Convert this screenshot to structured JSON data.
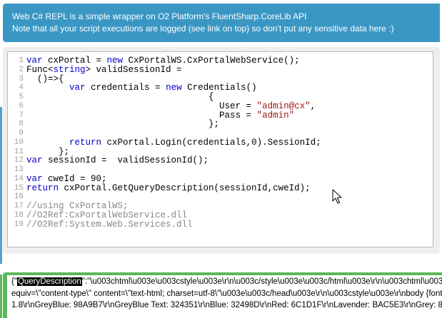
{
  "banner": {
    "line1": "Web C# REPL is a simple wrapper on O2 Platform's FluentSharp.CoreLib API",
    "line2": "Note that all your script executions are logged (see link on top) so don't put any sensitive data here :)"
  },
  "editor": {
    "lines": [
      {
        "num": "1",
        "parts": [
          {
            "t": "var",
            "c": "kw"
          },
          {
            "t": " cxPortal = "
          },
          {
            "t": "new",
            "c": "kw"
          },
          {
            "t": " CxPortalWS.CxPortalWebService();"
          }
        ]
      },
      {
        "num": "2",
        "parts": [
          {
            "t": "Func<"
          },
          {
            "t": "string",
            "c": "kw"
          },
          {
            "t": "> validSessionId ="
          }
        ]
      },
      {
        "num": "3",
        "parts": [
          {
            "t": "  ()=>{"
          }
        ]
      },
      {
        "num": "4",
        "parts": [
          {
            "t": "        "
          },
          {
            "t": "var",
            "c": "kw"
          },
          {
            "t": " credentials = "
          },
          {
            "t": "new",
            "c": "kw"
          },
          {
            "t": " Credentials()"
          }
        ]
      },
      {
        "num": "5",
        "parts": [
          {
            "t": "                                  {"
          }
        ]
      },
      {
        "num": "6",
        "parts": [
          {
            "t": "                                    User = "
          },
          {
            "t": "\"admin@cx\"",
            "c": "str"
          },
          {
            "t": ","
          }
        ]
      },
      {
        "num": "7",
        "parts": [
          {
            "t": "                                    Pass = "
          },
          {
            "t": "\"admin\"",
            "c": "str"
          }
        ]
      },
      {
        "num": "8",
        "parts": [
          {
            "t": "                                  };"
          }
        ]
      },
      {
        "num": "9",
        "parts": []
      },
      {
        "num": "10",
        "parts": [
          {
            "t": "        "
          },
          {
            "t": "return",
            "c": "kw"
          },
          {
            "t": " cxPortal.Login(credentials,0).SessionId;"
          }
        ]
      },
      {
        "num": "11",
        "parts": [
          {
            "t": "      };"
          }
        ]
      },
      {
        "num": "12",
        "parts": [
          {
            "t": "var",
            "c": "kw"
          },
          {
            "t": " sessionId =  validSessionId();"
          }
        ]
      },
      {
        "num": "13",
        "parts": []
      },
      {
        "num": "14",
        "parts": [
          {
            "t": "var",
            "c": "kw"
          },
          {
            "t": " cweId = 90;"
          }
        ]
      },
      {
        "num": "15",
        "parts": [
          {
            "t": "return",
            "c": "kw"
          },
          {
            "t": " cxPortal.GetQueryDescription(sessionId,cweId);"
          }
        ]
      },
      {
        "num": "16",
        "parts": []
      },
      {
        "num": "17",
        "parts": [
          {
            "t": "//using CxPortalWS;",
            "c": "cm"
          }
        ]
      },
      {
        "num": "18",
        "parts": [
          {
            "t": "//O2Ref:CxPortalWebService.dll",
            "c": "cm"
          }
        ]
      },
      {
        "num": "19",
        "parts": [
          {
            "t": "//O2Ref:System.Web.Services.dll",
            "c": "cm"
          }
        ]
      }
    ]
  },
  "result": {
    "open": "{\"",
    "highlight": "QueryDescription",
    "line1_rest": "\":\"\\u003chtml\\u003e\\u003cstyle\\u003e\\r\\n\\u003c/style\\u003e\\u003c/html\\u003e\\r\\n\\u003chtml\\u003e\\u003chead\\u003e\\u003cmeta http-",
    "line2": "equiv=\\\"content-type\\\" content=\\\"text-html; charset=utf-8\\\"\\u003e\\u003c/head\\u003e\\r\\n\\u003cstyle\\u003e\\r\\nbody {font-family: Verdana; font-size: 12px;}",
    "line3": "1.8\\r\\nGreyBlue: 98A9B7\\r\\nGreyBlue Text: 324351\\r\\nBlue: 32498D\\r\\nRed: 6C1D1F\\r\\nLavender: BAC5E3\\r\\nGrey: 8A8A8A\\r\\n"
  }
}
